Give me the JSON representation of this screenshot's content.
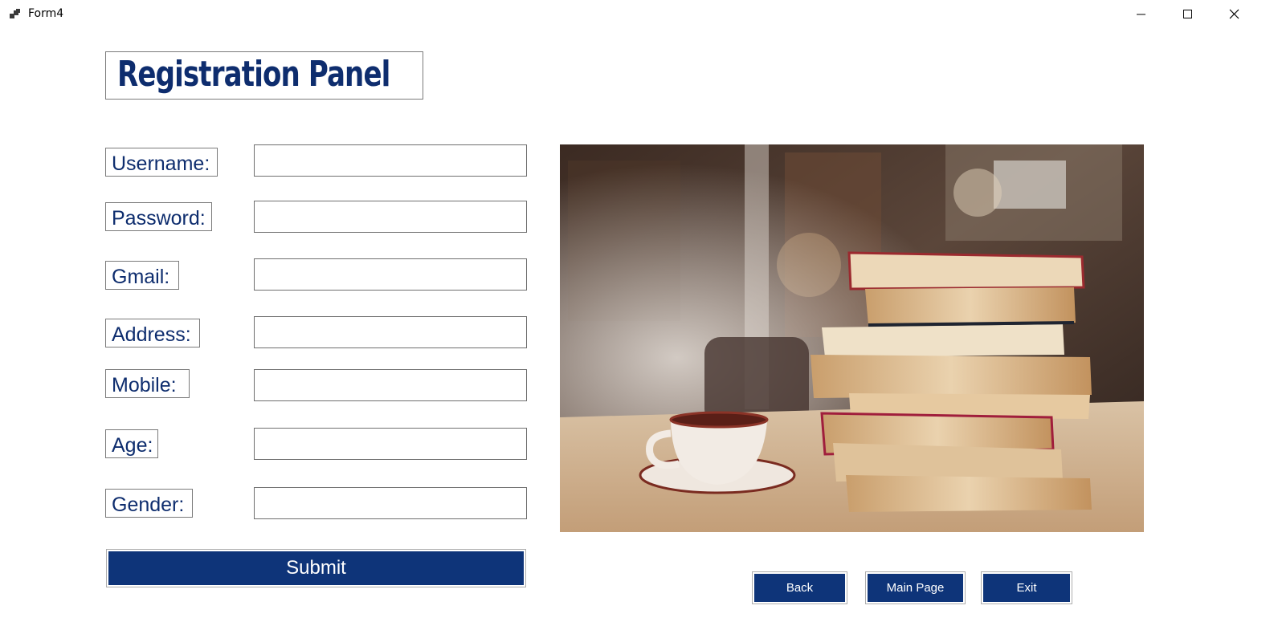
{
  "window": {
    "title": "Form4",
    "icons": {
      "app": "form-app-icon",
      "minimize": "minimize-icon",
      "maximize": "maximize-icon",
      "close": "close-icon"
    }
  },
  "form": {
    "heading": "Registration Panel",
    "fields": [
      {
        "label": "Username:",
        "value": ""
      },
      {
        "label": "Password:",
        "value": ""
      },
      {
        "label": "Gmail:",
        "value": ""
      },
      {
        "label": "Address:",
        "value": ""
      },
      {
        "label": "Mobile:",
        "value": ""
      },
      {
        "label": "Age:",
        "value": ""
      },
      {
        "label": "Gender:",
        "value": ""
      }
    ],
    "submit_label": "Submit"
  },
  "nav": {
    "back_label": "Back",
    "main_page_label": "Main Page",
    "exit_label": "Exit"
  },
  "image": {
    "subject": "stack-of-books-and-coffee-cup"
  },
  "colors": {
    "accent": "#0e3479",
    "label_text": "#0e2d6e",
    "background": "#ffffff"
  }
}
